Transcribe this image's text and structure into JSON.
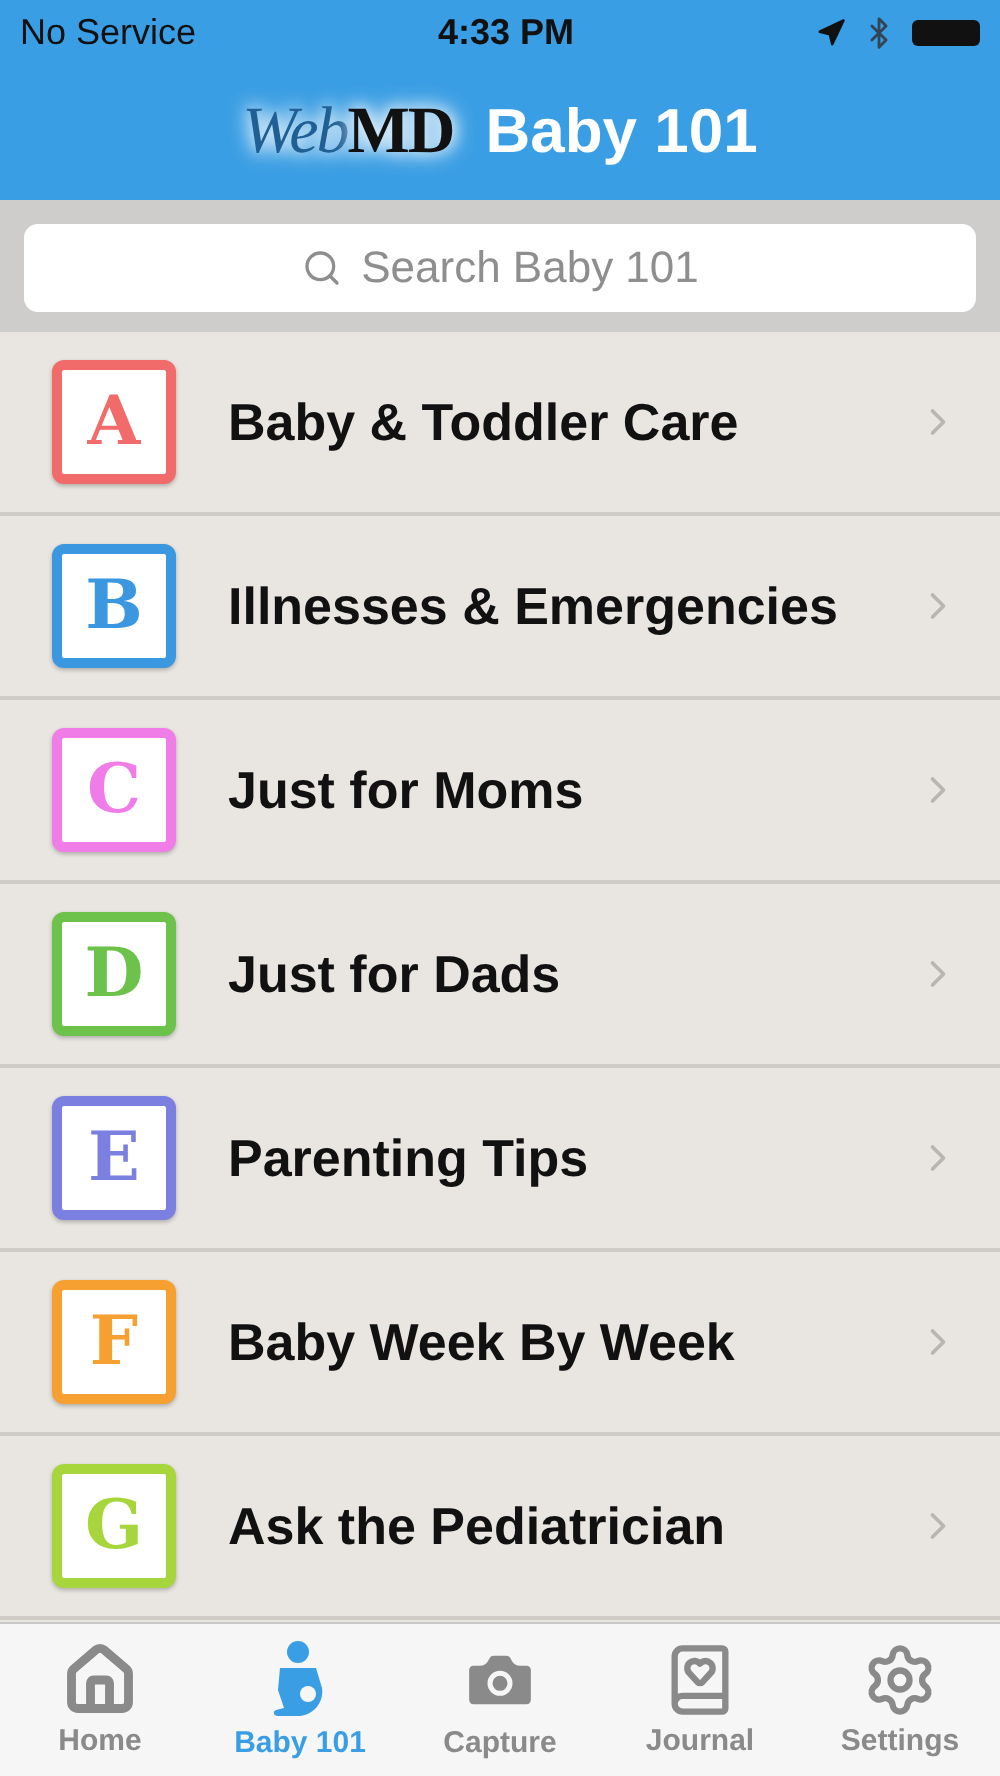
{
  "status_bar": {
    "carrier": "No Service",
    "time": "4:33 PM"
  },
  "header": {
    "logo_web": "Web",
    "logo_md": "MD",
    "title": "Baby 101"
  },
  "search": {
    "placeholder": "Search Baby 101"
  },
  "topics": [
    {
      "letter": "A",
      "label": "Baby & Toddler Care",
      "color": "#f26b6b"
    },
    {
      "letter": "B",
      "label": "Illnesses & Emergencies",
      "color": "#3b97e0"
    },
    {
      "letter": "C",
      "label": "Just for Moms",
      "color": "#f07ce8"
    },
    {
      "letter": "D",
      "label": "Just for Dads",
      "color": "#6cc24a"
    },
    {
      "letter": "E",
      "label": "Parenting Tips",
      "color": "#7b7fe0"
    },
    {
      "letter": "F",
      "label": "Baby Week By Week",
      "color": "#f7a032"
    },
    {
      "letter": "G",
      "label": "Ask the Pediatrician",
      "color": "#a6d63c"
    }
  ],
  "tab_bar": [
    {
      "kind": "home",
      "label": "Home",
      "selected": false
    },
    {
      "kind": "baby",
      "label": "Baby 101",
      "selected": true
    },
    {
      "kind": "camera",
      "label": "Capture",
      "selected": false
    },
    {
      "kind": "journal",
      "label": "Journal",
      "selected": false
    },
    {
      "kind": "settings",
      "label": "Settings",
      "selected": false
    }
  ]
}
